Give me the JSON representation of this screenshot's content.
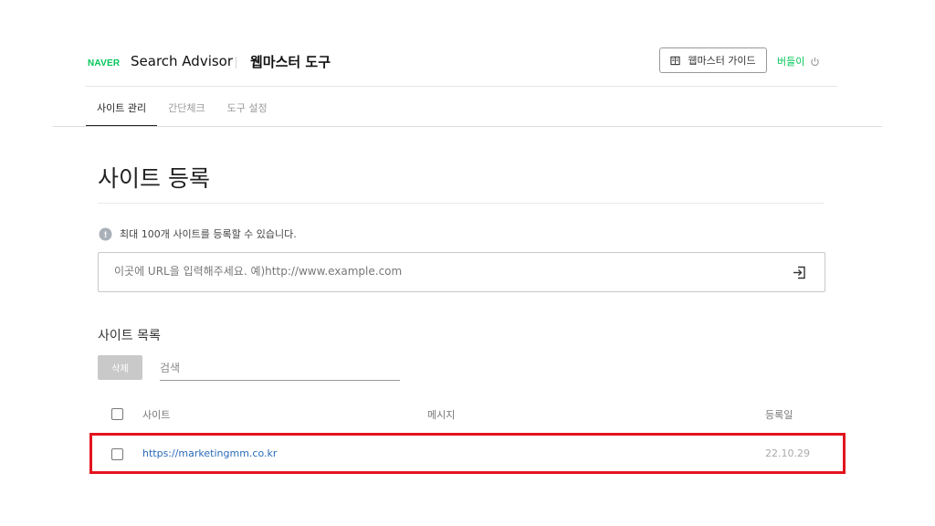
{
  "header": {
    "logo": "NAVER",
    "brand": "Search Advisor",
    "tool_title": "웹마스터 도구",
    "guide_label": "웹마스터 가이드",
    "user_name": "버들이"
  },
  "tabs": [
    {
      "label": "사이트 관리",
      "active": true
    },
    {
      "label": "간단체크",
      "active": false
    },
    {
      "label": "도구 설정",
      "active": false
    }
  ],
  "main": {
    "title": "사이트 등록",
    "notice": "최대 100개 사이트를 등록할 수 있습니다.",
    "url_placeholder": "이곳에 URL을 입력해주세요. 예)http://www.example.com"
  },
  "list": {
    "title": "사이트 목록",
    "delete_label": "삭제",
    "search_placeholder": "검색",
    "columns": {
      "site": "사이트",
      "message": "메시지",
      "date": "등록일"
    },
    "rows": [
      {
        "site": "https://marketingmm.co.kr",
        "message": "",
        "date": "22.10.29"
      }
    ]
  },
  "colors": {
    "brand_green": "#03c75a",
    "link_blue": "#2a6bb8",
    "highlight_red": "#e3141e"
  }
}
